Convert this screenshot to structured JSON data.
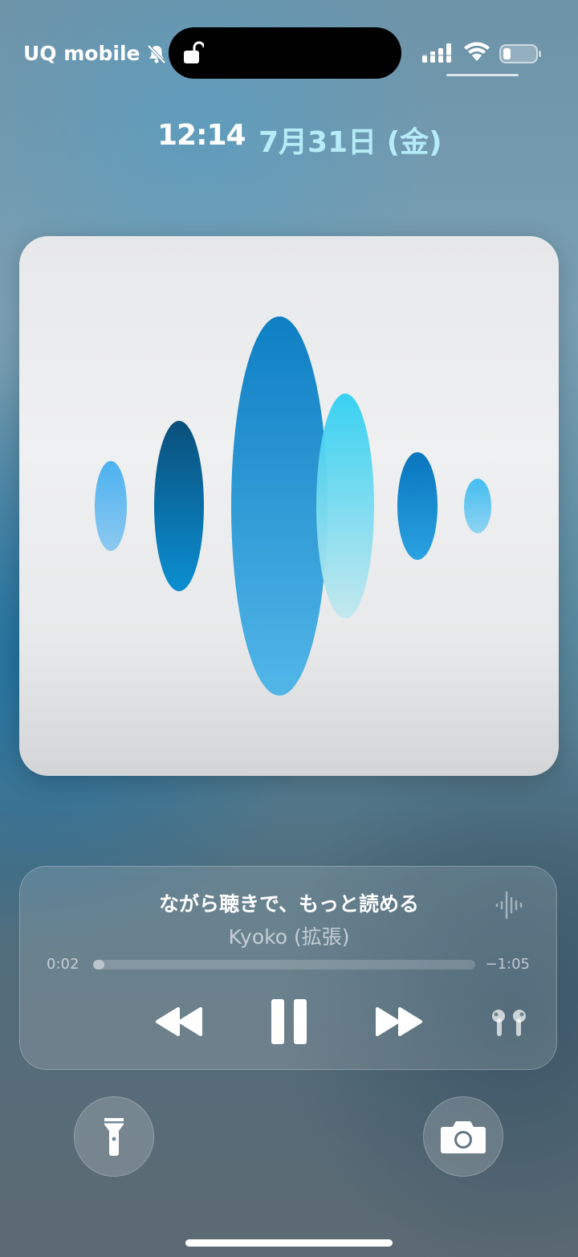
{
  "status_bar": {
    "carrier": "UQ mobile",
    "icons": [
      "bell-slash-icon",
      "lock-open-icon",
      "signal-icon",
      "wifi-icon",
      "battery-icon"
    ]
  },
  "lock_screen": {
    "time": "12:14",
    "date": "7月31日 (金)"
  },
  "now_playing": {
    "title": "ながら聴きで、もっと読める",
    "artist": "Kyoko (拡張)",
    "elapsed": "0:02",
    "remaining": "−1:05",
    "progress": 0.03,
    "controls": [
      "rewind-icon",
      "pause-icon",
      "fast-forward-icon",
      "airpods-icon"
    ]
  },
  "quick_actions": [
    "flashlight-icon",
    "camera-icon"
  ],
  "colors": {
    "date_accent": "#b5ecf7",
    "artwork_blue": "#2a8fcf",
    "artwork_cyan": "#3fd0f0"
  }
}
